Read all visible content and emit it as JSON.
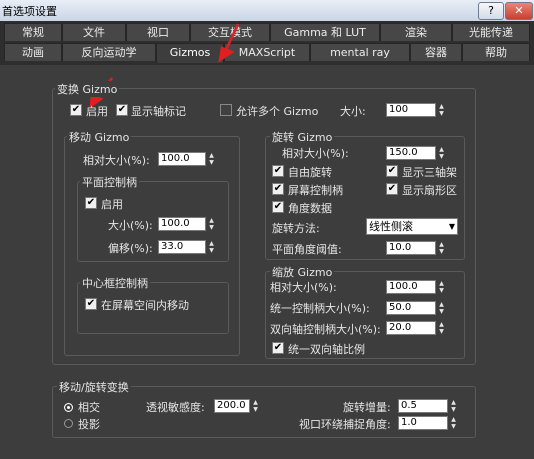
{
  "window": {
    "title": "首选项设置",
    "help_label": "?",
    "close_label": "✕"
  },
  "tabs_row1": [
    "常规",
    "文件",
    "视口",
    "交互模式",
    "Gamma 和 LUT",
    "渲染",
    "光能传递"
  ],
  "tabs_row2": [
    "动画",
    "反向运动学",
    "Gizmos",
    "MAXScript",
    "mental ray",
    "容器",
    "帮助"
  ],
  "active_tab": "Gizmos",
  "transform_gizmo": {
    "title": "变换 Gizmo",
    "enable": {
      "label": "启用",
      "checked": true
    },
    "show_axis_labels": {
      "label": "显示轴标记",
      "checked": true
    },
    "allow_multiple": {
      "label": "允许多个 Gizmo",
      "checked": false
    },
    "size": {
      "label": "大小:",
      "value": "100"
    }
  },
  "move_gizmo": {
    "title": "移动 Gizmo",
    "relative_size": {
      "label": "相对大小(%):",
      "value": "100.0"
    },
    "plane_handles": {
      "title": "平面控制柄",
      "enable": {
        "label": "启用",
        "checked": true
      },
      "size": {
        "label": "大小(%):",
        "value": "100.0"
      },
      "offset": {
        "label": "偏移(%):",
        "value": "33.0"
      }
    },
    "center_box": {
      "title": "中心框控制柄",
      "screen_space_move": {
        "label": "在屏幕空间内移动",
        "checked": true
      }
    }
  },
  "rotate_gizmo": {
    "title": "旋转 Gizmo",
    "relative_size": {
      "label": "相对大小(%):",
      "value": "150.0"
    },
    "free_rotation": {
      "label": "自由旋转",
      "checked": true
    },
    "show_three_axes": {
      "label": "显示三轴架",
      "checked": true
    },
    "screen_handle": {
      "label": "屏幕控制柄",
      "checked": true
    },
    "show_sector": {
      "label": "显示扇形区",
      "checked": true
    },
    "angle_data": {
      "label": "角度数据",
      "checked": true
    },
    "rotation_method": {
      "label": "旋转方法:",
      "value": "线性侧滚"
    },
    "plane_angle_threshold": {
      "label": "平面角度阈值:",
      "value": "10.0"
    }
  },
  "scale_gizmo": {
    "title": "缩放 Gizmo",
    "relative_size": {
      "label": "相对大小(%):",
      "value": "100.0"
    },
    "uniform_handle_size": {
      "label": "统一控制柄大小(%):",
      "value": "50.0"
    },
    "dual_axis_handle_size": {
      "label": "双向轴控制柄大小(%):",
      "value": "20.0"
    },
    "uniform_dual_axis_scale": {
      "label": "统一双向轴比例",
      "checked": true
    }
  },
  "move_rotate_transform": {
    "title": "移动/旋转变换",
    "radio_relative": {
      "label": "相交",
      "selected": true
    },
    "radio_projection": {
      "label": "投影",
      "selected": false
    },
    "perspective_sensitivity": {
      "label": "透视敏感度:",
      "value": "200.0"
    },
    "rotation_increment": {
      "label": "旋转增量:",
      "value": "0.5"
    },
    "viewport_arcrotate_snap": {
      "label": "视口环绕捕捉角度:",
      "value": "1.0"
    }
  },
  "colors": {
    "panel": "#3d3d3d",
    "tabstrip": "#2e2e2e",
    "arrow_annotation": "#e02020"
  }
}
